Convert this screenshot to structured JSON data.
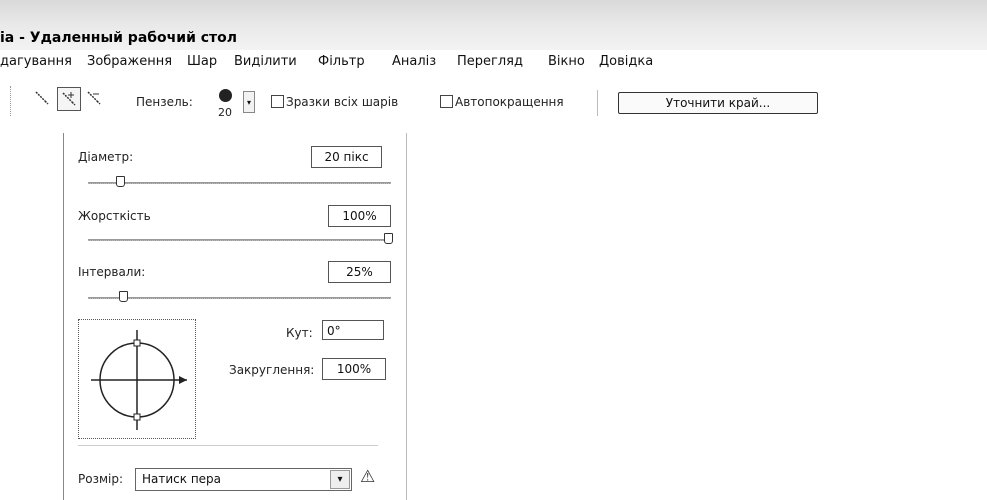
{
  "window": {
    "title": "ia - Удаленный рабочий стол"
  },
  "menu": [
    {
      "label": "дагування"
    },
    {
      "label": "Зображення"
    },
    {
      "label": "Шар"
    },
    {
      "label": "Виділити"
    },
    {
      "label": "Фільтр"
    },
    {
      "label": "Аналіз"
    },
    {
      "label": "Перегляд"
    },
    {
      "label": "Вікно"
    },
    {
      "label": "Довідка"
    }
  ],
  "toolbar": {
    "tool_icons": [
      "quick-selection-icon",
      "quick-selection-add-icon",
      "quick-selection-subtract-icon"
    ],
    "brush_label": "Пензель:",
    "brush_size": "20",
    "sample_all_layers_label": "Зразки всіх шарів",
    "auto_enhance_label": "Автопокращення",
    "refine_edge_label": "Уточнити край..."
  },
  "brush_panel": {
    "diameter_label": "Діаметр:",
    "diameter_value": "20 пікс",
    "diameter_slider_fraction": 0.1,
    "hardness_label": "Жорсткість",
    "hardness_value": "100%",
    "hardness_slider_fraction": 1.0,
    "spacing_label": "Інтервали:",
    "spacing_value": "25%",
    "spacing_slider_fraction": 0.1,
    "angle_label": "Кут:",
    "angle_value": "0°",
    "roundness_label": "Закруглення:",
    "roundness_value": "100%",
    "size_label": "Розмір:",
    "size_value": "Натиск пера",
    "warning_icon": "warning-icon"
  }
}
